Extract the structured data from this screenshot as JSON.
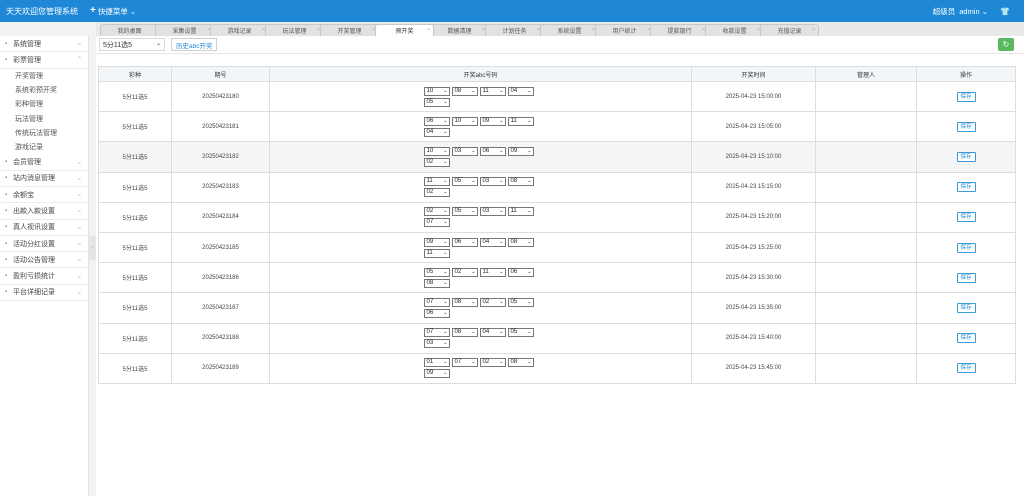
{
  "header": {
    "brand": "天天欢迎您管理系统",
    "quick_menu": "快捷菜单",
    "user_role": "超级员",
    "user_name": "admin"
  },
  "tabs": [
    {
      "label": "我的桌面",
      "active": false
    },
    {
      "label": "采集设置",
      "active": false
    },
    {
      "label": "游戏记录",
      "active": false
    },
    {
      "label": "玩法管理",
      "active": false
    },
    {
      "label": "开奖管理",
      "active": false
    },
    {
      "label": "预开奖",
      "active": true
    },
    {
      "label": "数据清理",
      "active": false
    },
    {
      "label": "计划任务",
      "active": false
    },
    {
      "label": "系统设置",
      "active": false
    },
    {
      "label": "用户统计",
      "active": false
    },
    {
      "label": "提款银行",
      "active": false
    },
    {
      "label": "收款设置",
      "active": false
    },
    {
      "label": "充值记录",
      "active": false
    }
  ],
  "sidebar": {
    "items": [
      {
        "label": "系统管理"
      },
      {
        "label": "彩票管理"
      },
      {
        "label": "会员管理"
      },
      {
        "label": "站内消息管理"
      },
      {
        "label": "余额宝"
      },
      {
        "label": "出款入款设置"
      },
      {
        "label": "真人视讯设置"
      },
      {
        "label": "活动分红设置"
      },
      {
        "label": "活动公告管理"
      },
      {
        "label": "盈利亏损统计"
      },
      {
        "label": "平台详细记录"
      }
    ],
    "lottery_sub": [
      "开奖管理",
      "系统彩预开奖",
      "彩种管理",
      "玩法管理",
      "传统玩法管理",
      "游戏记录"
    ]
  },
  "toolbar": {
    "game_select": "5分11选5",
    "history_button": "历史abc开奖"
  },
  "table": {
    "headers": [
      "彩种",
      "期号",
      "开奖abc号码",
      "开奖时间",
      "管理人",
      "操作"
    ],
    "save_label": "保存",
    "rows": [
      {
        "game": "5分11选5",
        "period": "20250423180",
        "numbers": [
          "10",
          "08",
          "11",
          "04",
          "05"
        ],
        "time": "2025-04-23 15:00:00",
        "admin": ""
      },
      {
        "game": "5分11选5",
        "period": "20250423181",
        "numbers": [
          "06",
          "10",
          "09",
          "11",
          "04"
        ],
        "time": "2025-04-23 15:05:00",
        "admin": ""
      },
      {
        "game": "5分11选5",
        "period": "20250423182",
        "numbers": [
          "10",
          "03",
          "06",
          "09",
          "02"
        ],
        "time": "2025-04-23 15:10:00",
        "admin": ""
      },
      {
        "game": "5分11选5",
        "period": "20250423183",
        "numbers": [
          "11",
          "05",
          "03",
          "08",
          "02"
        ],
        "time": "2025-04-23 15:15:00",
        "admin": ""
      },
      {
        "game": "5分11选5",
        "period": "20250423184",
        "numbers": [
          "02",
          "05",
          "03",
          "11",
          "07"
        ],
        "time": "2025-04-23 15:20:00",
        "admin": ""
      },
      {
        "game": "5分11选5",
        "period": "20250423185",
        "numbers": [
          "09",
          "06",
          "04",
          "08",
          "11"
        ],
        "time": "2025-04-23 15:25:00",
        "admin": ""
      },
      {
        "game": "5分11选5",
        "period": "20250423186",
        "numbers": [
          "05",
          "02",
          "11",
          "06",
          "08"
        ],
        "time": "2025-04-23 15:30:00",
        "admin": ""
      },
      {
        "game": "5分11选5",
        "period": "20250423187",
        "numbers": [
          "07",
          "08",
          "02",
          "05",
          "06"
        ],
        "time": "2025-04-23 15:35:00",
        "admin": ""
      },
      {
        "game": "5分11选5",
        "period": "20250423188",
        "numbers": [
          "07",
          "08",
          "04",
          "05",
          "03"
        ],
        "time": "2025-04-23 15:40:00",
        "admin": ""
      },
      {
        "game": "5分11选5",
        "period": "20250423189",
        "numbers": [
          "01",
          "07",
          "02",
          "08",
          "09"
        ],
        "time": "2025-04-23 15:45:00",
        "admin": ""
      }
    ]
  }
}
